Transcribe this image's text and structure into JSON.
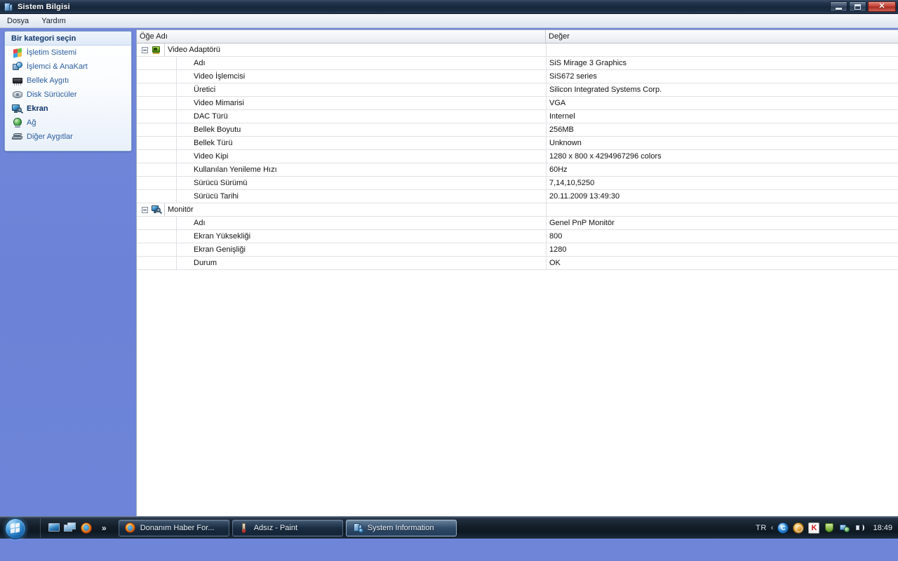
{
  "window": {
    "title": "Sistem Bilgisi",
    "app_icon": "computer-icon",
    "buttons": {
      "minimize": "minimize-icon",
      "restore": "restore-icon",
      "close": "✕"
    }
  },
  "menubar": {
    "items": [
      {
        "label": "Dosya"
      },
      {
        "label": "Yardım"
      }
    ]
  },
  "sidebar": {
    "header": "Bir kategori seçin",
    "items": [
      {
        "label": "İşletim Sistemi",
        "icon": "windows-flag-icon",
        "selected": false
      },
      {
        "label": "İşlemci & AnaKart",
        "icon": "cpu-icon",
        "selected": false
      },
      {
        "label": "Bellek Aygıtı",
        "icon": "memory-chip-icon",
        "selected": false
      },
      {
        "label": "Disk Sürücüler",
        "icon": "disk-drive-icon",
        "selected": false
      },
      {
        "label": "Ekran",
        "icon": "display-icon",
        "selected": true
      },
      {
        "label": "Ağ",
        "icon": "network-globe-icon",
        "selected": false
      },
      {
        "label": "Diğer Aygıtlar",
        "icon": "other-devices-icon",
        "selected": false
      }
    ]
  },
  "grid": {
    "columns": [
      {
        "label": "Öğe Adı"
      },
      {
        "label": "Değer"
      }
    ],
    "groups": [
      {
        "label": "Video Adaptörü",
        "icon": "video-adapter-icon",
        "value": "",
        "rows": [
          {
            "name": "Adı",
            "value": "SiS Mirage 3 Graphics"
          },
          {
            "name": "Video İşlemcisi",
            "value": "SiS672 series"
          },
          {
            "name": "Üretici",
            "value": "Silicon Integrated Systems Corp."
          },
          {
            "name": "Video Mimarisi",
            "value": "VGA"
          },
          {
            "name": "DAC Türü",
            "value": "Internel"
          },
          {
            "name": "Bellek Boyutu",
            "value": "256MB"
          },
          {
            "name": "Bellek Türü",
            "value": "Unknown"
          },
          {
            "name": "Video Kipi",
            "value": "1280 x 800 x 4294967296 colors"
          },
          {
            "name": "Kullanılan Yenileme Hızı",
            "value": "60Hz"
          },
          {
            "name": "Sürücü Sürümü",
            "value": "7,14,10,5250"
          },
          {
            "name": "Sürücü Tarihi",
            "value": "20.11.2009 13:49:30"
          }
        ]
      },
      {
        "label": "Monitör",
        "icon": "monitor-icon",
        "value": "",
        "rows": [
          {
            "name": "Adı",
            "value": "Genel PnP Monitör"
          },
          {
            "name": "Ekran Yüksekliği",
            "value": "800"
          },
          {
            "name": "Ekran Genişliği",
            "value": "1280"
          },
          {
            "name": "Durum",
            "value": "OK"
          }
        ]
      }
    ]
  },
  "taskbar": {
    "start": "start-orb-icon",
    "quicklaunch": [
      {
        "icon": "show-desktop-icon"
      },
      {
        "icon": "switch-windows-icon"
      },
      {
        "icon": "firefox-icon"
      }
    ],
    "quicklaunch_more": "»",
    "tasks": [
      {
        "label": "Donanım Haber For...",
        "icon": "firefox-icon",
        "active": false
      },
      {
        "label": "Adsız - Paint",
        "icon": "paint-icon",
        "active": false
      },
      {
        "label": "System Information",
        "icon": "system-information-icon",
        "active": true
      }
    ],
    "tray": {
      "language": "TR",
      "chevron": "‹",
      "icons": [
        {
          "name": "comodo-icon"
        },
        {
          "name": "network-config-icon"
        },
        {
          "name": "kaspersky-icon"
        },
        {
          "name": "shield-icon"
        },
        {
          "name": "lan-connection-icon"
        },
        {
          "name": "volume-icon"
        }
      ],
      "clock": "18:49"
    }
  },
  "colors": {
    "desktop": "#6e85d8",
    "titlebar": "#17283d",
    "accent_link": "#2a5c9c",
    "close_button": "#c5453a"
  }
}
